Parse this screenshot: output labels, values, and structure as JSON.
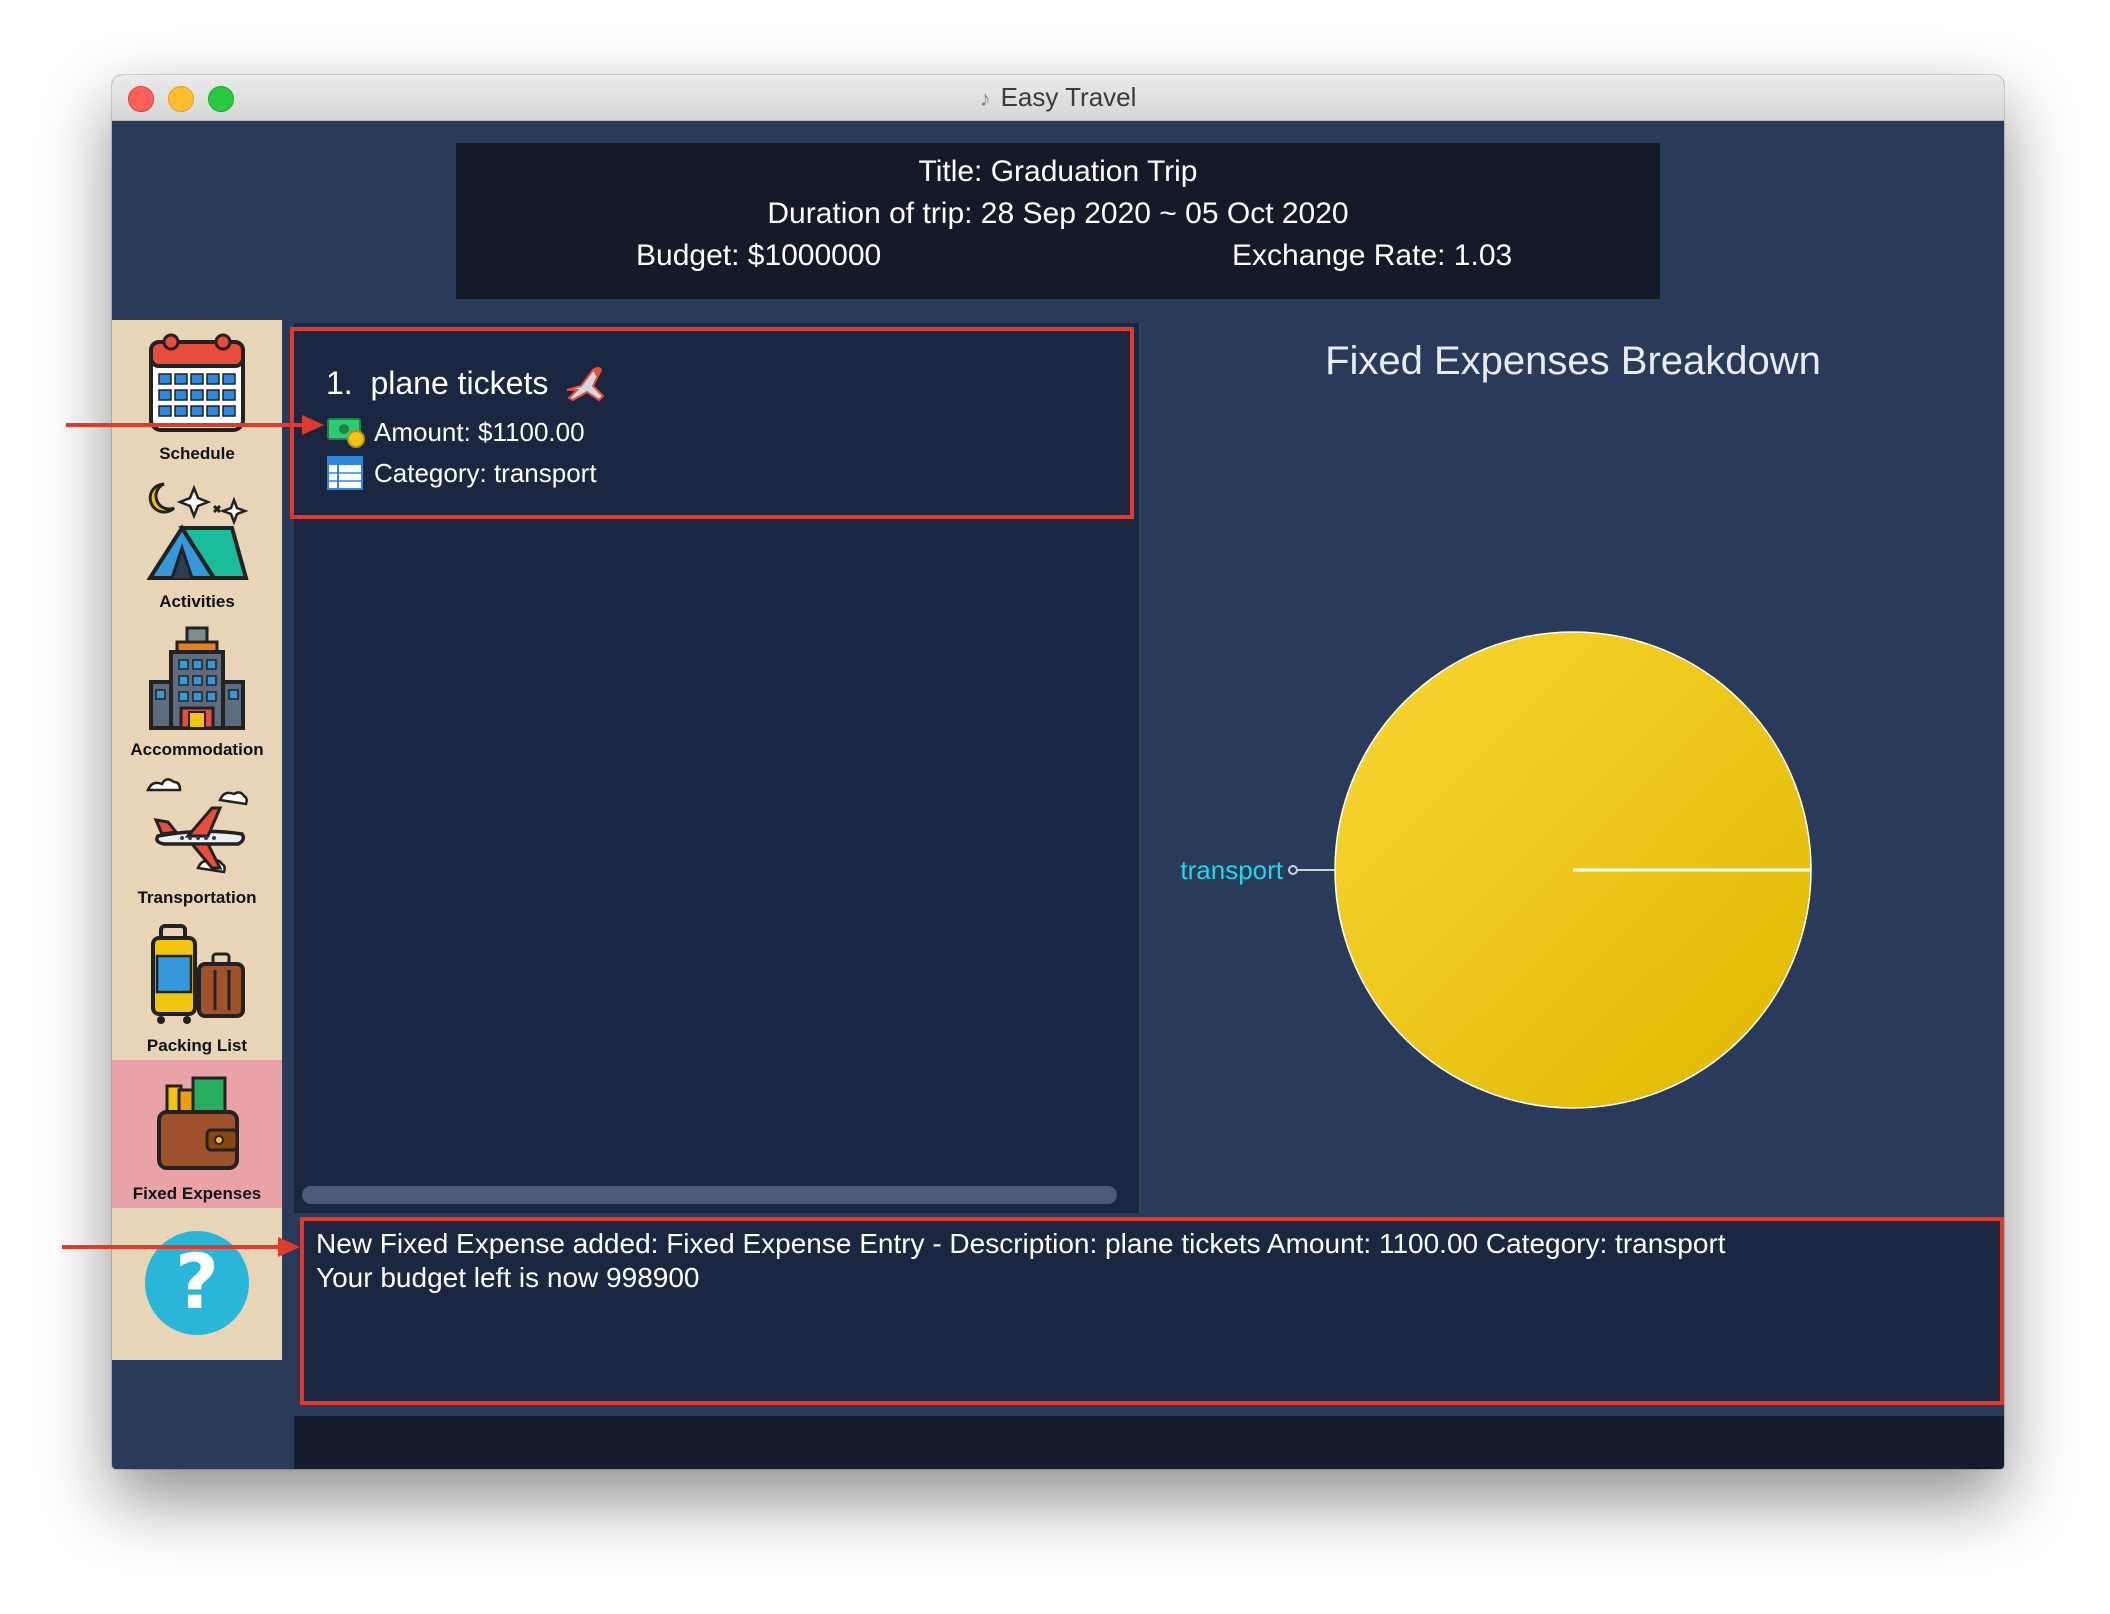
{
  "window": {
    "title": "Easy Travel"
  },
  "header": {
    "title_line": "Title: Graduation Trip",
    "duration_line": "Duration of trip: 28 Sep 2020 ~ 05 Oct 2020",
    "budget_line": "Budget: $1000000",
    "exchange_line": "Exchange Rate: 1.03"
  },
  "sidebar": {
    "items": [
      {
        "label": "Schedule",
        "icon": "calendar-icon"
      },
      {
        "label": "Activities",
        "icon": "camping-tent-icon"
      },
      {
        "label": "Accommodation",
        "icon": "hotel-icon"
      },
      {
        "label": "Transportation",
        "icon": "airplane-icon"
      },
      {
        "label": "Packing List",
        "icon": "luggage-icon"
      },
      {
        "label": "Fixed Expenses",
        "icon": "wallet-icon",
        "active": true
      },
      {
        "label": "",
        "icon": "help-icon"
      }
    ]
  },
  "expense": {
    "index": "1.",
    "description": "plane tickets",
    "amount_line": "Amount: $1100.00",
    "category_line": "Category: transport"
  },
  "chart_data": {
    "type": "pie",
    "title": "Fixed Expenses Breakdown",
    "categories": [
      "transport"
    ],
    "values": [
      1100.0
    ],
    "colors": [
      "#f0c419"
    ],
    "legend": "none"
  },
  "result": {
    "line1": "New Fixed Expense added: Fixed Expense Entry - Description: plane tickets Amount: 1100.00 Category: transport",
    "line2": "Your budget left is now 998900"
  },
  "command": {
    "value": ""
  }
}
